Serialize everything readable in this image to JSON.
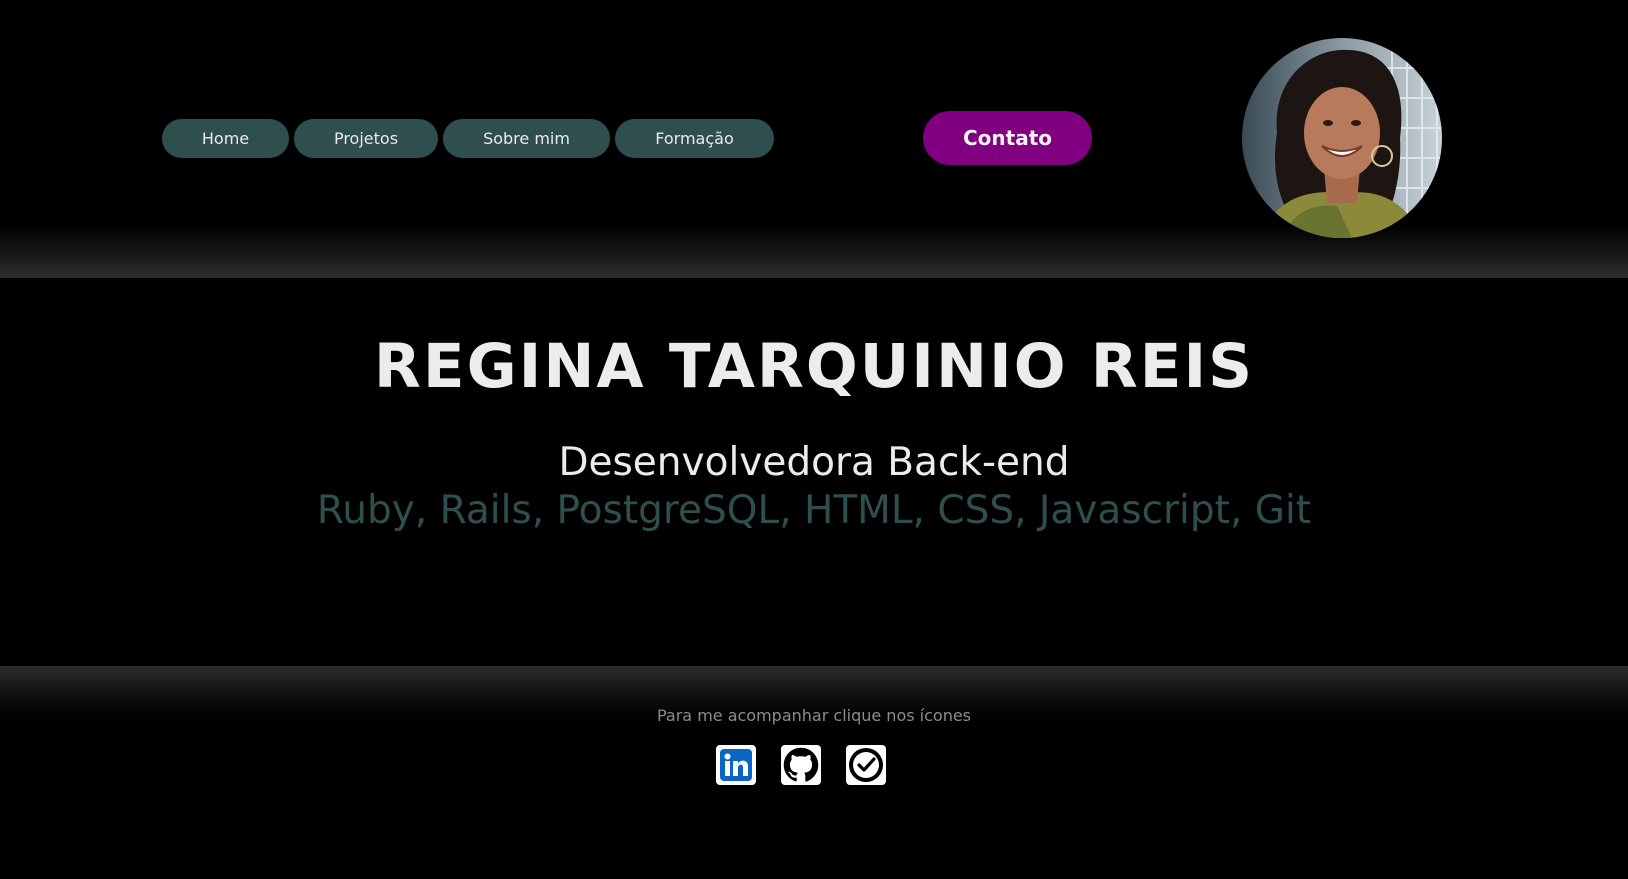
{
  "nav": {
    "items": [
      {
        "label": "Home"
      },
      {
        "label": "Projetos"
      },
      {
        "label": "Sobre mim"
      },
      {
        "label": "Formação"
      }
    ],
    "contact_label": "Contato"
  },
  "hero": {
    "name": "REGINA TARQUINIO REIS",
    "role": "Desenvolvedora Back-end",
    "skills": "Ruby, Rails, PostgreSQL, HTML, CSS, Javascript, Git"
  },
  "footer": {
    "text": "Para me acompanhar clique nos ícones",
    "icons": [
      "linkedin-icon",
      "github-icon",
      "check-circle-icon"
    ]
  },
  "colors": {
    "nav_button": "#2f4f4f",
    "contact_button": "#800080",
    "skills_text": "#2f4f4f",
    "linkedin_blue": "#0a66c2"
  }
}
